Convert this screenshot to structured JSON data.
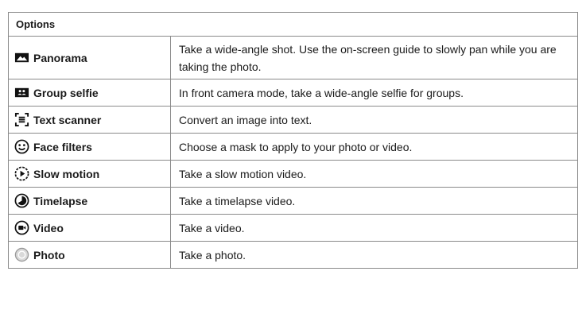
{
  "table": {
    "header": "Options",
    "rows": [
      {
        "icon": "panorama-icon",
        "label": "Panorama",
        "description": "Take a wide-angle shot. Use the on-screen guide to slowly pan while you are taking the photo."
      },
      {
        "icon": "group-selfie-icon",
        "label": "Group selfie",
        "description": "In front camera mode, take a wide-angle selfie for groups."
      },
      {
        "icon": "text-scanner-icon",
        "label": "Text scanner",
        "description": "Convert an image into text."
      },
      {
        "icon": "face-filter-icon",
        "label": "Face filters",
        "description": "Choose a mask to apply to your photo or video."
      },
      {
        "icon": "slow-motion-icon",
        "label": "Slow motion",
        "description": "Take a slow motion video."
      },
      {
        "icon": "timelapse-icon",
        "label": "Timelapse",
        "description": "Take a timelapse video."
      },
      {
        "icon": "video-icon",
        "label": "Video",
        "description": "Take a video."
      },
      {
        "icon": "photo-icon",
        "label": "Photo",
        "description": "Take a photo."
      }
    ]
  }
}
